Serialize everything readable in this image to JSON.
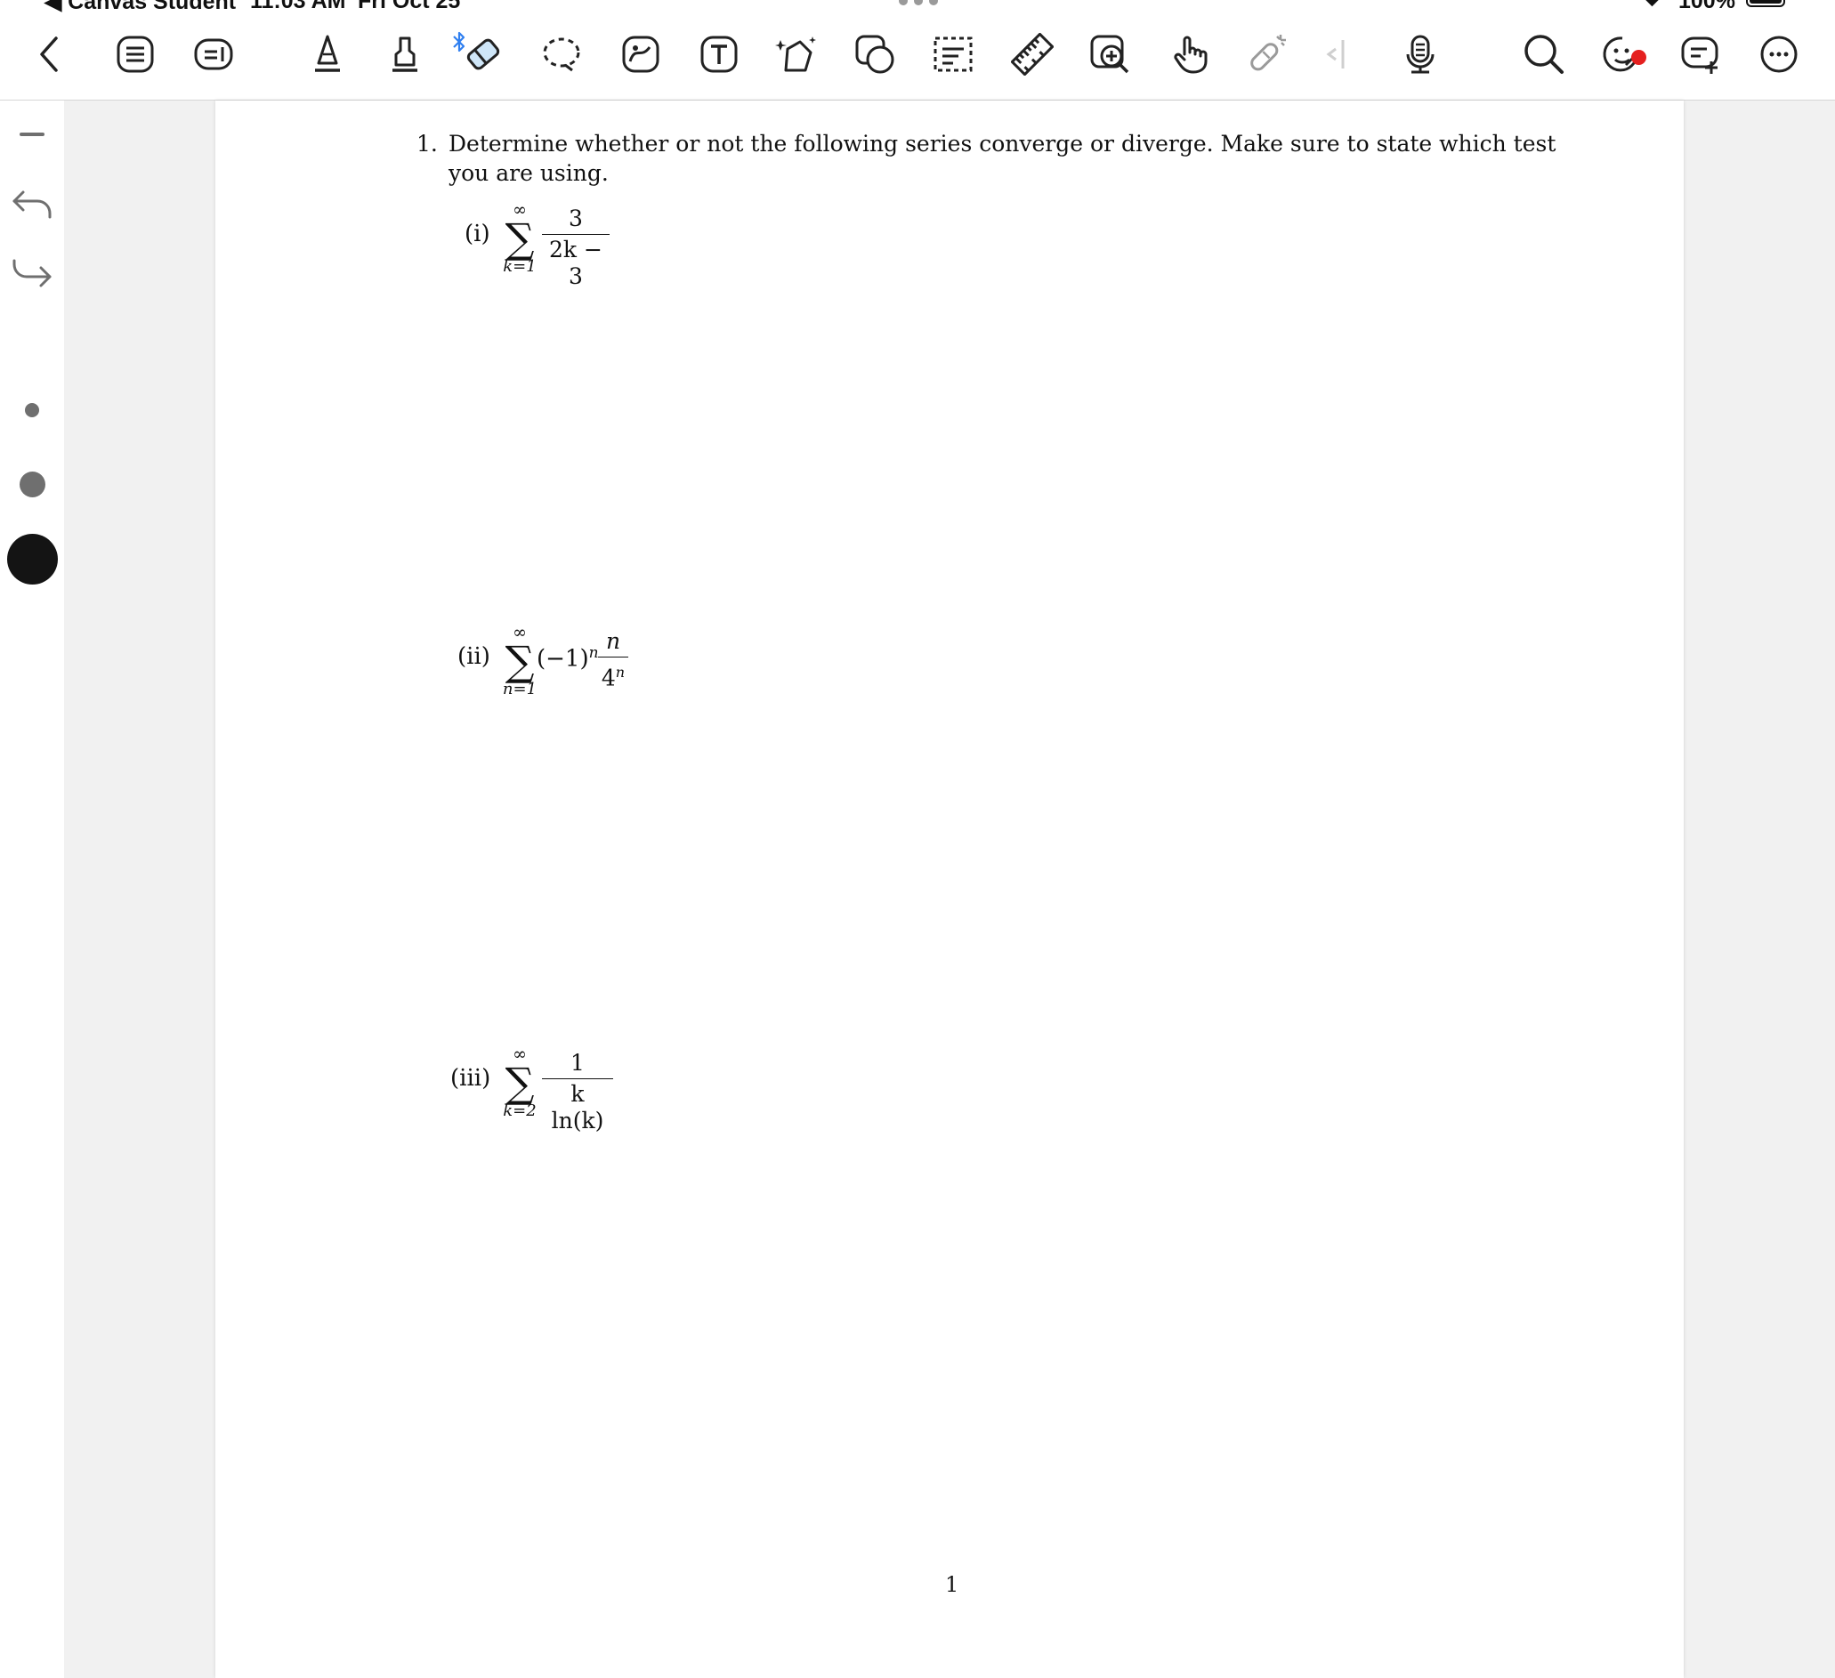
{
  "statusbar": {
    "app": "◀ Canvas Student",
    "time": "11:03 AM",
    "date": "Fri Oct 25",
    "battery": "100%"
  },
  "toolbar": {
    "icons": [
      "back-chevron-icon",
      "list-icon",
      "comment-bubble-icon",
      "pen-icon",
      "marker-icon",
      "eraser-icon",
      "lasso-icon",
      "image-sticker-icon",
      "text-box-icon",
      "shape-star-icon",
      "shapes-icon",
      "select-box-icon",
      "ruler-icon",
      "zoom-add-icon",
      "hand-pointer-icon",
      "laser-pointer-icon",
      "collapse-icon",
      "microphone-icon",
      "search-icon",
      "sticker-face-icon",
      "add-note-icon",
      "more-icon"
    ]
  },
  "document": {
    "question_number": "1.",
    "question_text": "Determine whether or not the following series converge or diverge. Make sure to state which test you are using.",
    "parts": [
      {
        "label": "(i)",
        "upper": "∞",
        "lower": "k=1",
        "prefix": "",
        "numerator": "3",
        "denominator": "2k − 3"
      },
      {
        "label": "(ii)",
        "upper": "∞",
        "lower": "n=1",
        "prefix": "(−1)",
        "prefix_exp": "n",
        "numerator": "n",
        "denominator": "4",
        "denominator_exp": "n"
      },
      {
        "label": "(iii)",
        "upper": "∞",
        "lower": "k=2",
        "prefix": "",
        "numerator": "1",
        "denominator": "k ln(k)"
      }
    ],
    "page_number": "1"
  },
  "colors": {
    "bluetooth": "#2f7ff0",
    "notification": "#e5201f",
    "eraser_fill": "#cfe6f8",
    "rail_gray": "#6f6f6f"
  }
}
